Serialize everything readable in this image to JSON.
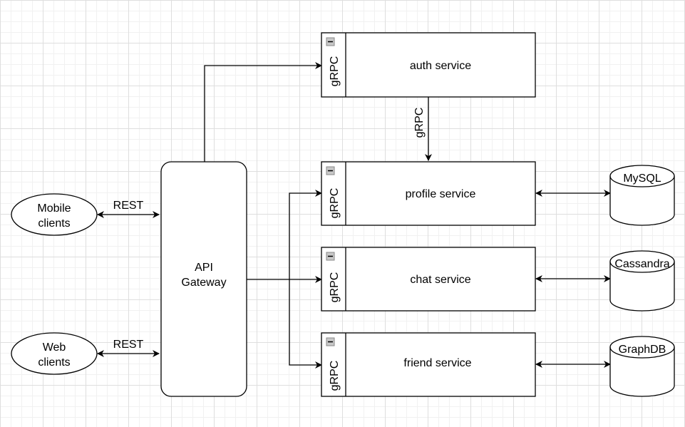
{
  "diagram": {
    "clients": [
      {
        "id": "mobile",
        "line1": "Mobile",
        "line2": "clients",
        "protocol": "REST"
      },
      {
        "id": "web",
        "line1": "Web",
        "line2": "clients",
        "protocol": "REST"
      }
    ],
    "gateway": {
      "line1": "API",
      "line2": "Gateway"
    },
    "services": [
      {
        "id": "auth",
        "label": "auth service",
        "interface": "gRPC"
      },
      {
        "id": "profile",
        "label": "profile service",
        "interface": "gRPC"
      },
      {
        "id": "chat",
        "label": "chat service",
        "interface": "gRPC"
      },
      {
        "id": "friend",
        "label": "friend service",
        "interface": "gRPC"
      }
    ],
    "auth_to_profile_label": "gRPC",
    "databases": [
      {
        "id": "mysql",
        "label": "MySQL"
      },
      {
        "id": "cassandra",
        "label": "Cassandra"
      },
      {
        "id": "graphdb",
        "label": "GraphDB"
      }
    ],
    "colors": {
      "stroke": "#000000",
      "fill": "#ffffff",
      "grid_major": "#dedede",
      "grid_minor": "#f1f1f1",
      "collapse_icon": "#c8c8c8"
    }
  }
}
